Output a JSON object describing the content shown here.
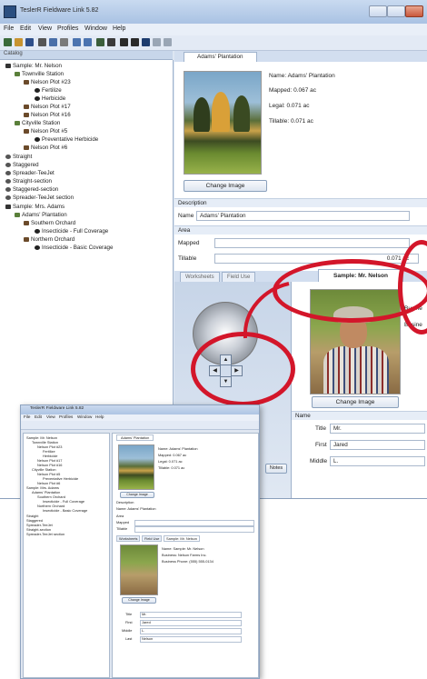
{
  "window": {
    "title": "TeslerR Fieldware Link 5.82",
    "menu": [
      "File",
      "Edit",
      "View",
      "Profiles",
      "Window",
      "Help"
    ]
  },
  "catalog": {
    "header": "Catalog",
    "tree": [
      {
        "label": "Sample: Mr. Nelson",
        "level": 0,
        "icon": "person-icon"
      },
      {
        "label": "Townville Station",
        "level": 1,
        "icon": "farm-icon"
      },
      {
        "label": "Nelson Plot #23",
        "level": 2,
        "icon": "field-icon"
      },
      {
        "label": "Fertilize",
        "level": 3,
        "icon": "spray-icon"
      },
      {
        "label": "Herbicide",
        "level": 3,
        "icon": "spray-icon"
      },
      {
        "label": "Nelson Plot #17",
        "level": 2,
        "icon": "field-icon"
      },
      {
        "label": "Nelson Plot #16",
        "level": 2,
        "icon": "field-icon"
      },
      {
        "label": "Cityville Station",
        "level": 1,
        "icon": "farm-icon"
      },
      {
        "label": "Nelson Plot #5",
        "level": 2,
        "icon": "field-icon"
      },
      {
        "label": "Preventative Herbicide",
        "level": 3,
        "icon": "spray-icon"
      },
      {
        "label": "Nelson Plot #6",
        "level": 2,
        "icon": "field-icon"
      },
      {
        "label": "Straight",
        "level": 0,
        "icon": "pattern-icon"
      },
      {
        "label": "Staggered",
        "level": 0,
        "icon": "pattern-icon"
      },
      {
        "label": "Spreader-TeeJet",
        "level": 0,
        "icon": "pattern-icon"
      },
      {
        "label": "Straight-section",
        "level": 0,
        "icon": "pattern-icon"
      },
      {
        "label": "Staggered-section",
        "level": 0,
        "icon": "pattern-icon"
      },
      {
        "label": "Spreader-TeeJet section",
        "level": 0,
        "icon": "pattern-icon"
      },
      {
        "label": "Sample: Mrs. Adams",
        "level": 0,
        "icon": "person-icon"
      },
      {
        "label": "Adams' Plantation",
        "level": 1,
        "icon": "farm-icon"
      },
      {
        "label": "Southern Orchard",
        "level": 2,
        "icon": "field-icon"
      },
      {
        "label": "Insecticide - Full Coverage",
        "level": 3,
        "icon": "spray-icon"
      },
      {
        "label": "Northern Orchard",
        "level": 2,
        "icon": "field-icon"
      },
      {
        "label": "Insecticide - Basic Coverage",
        "level": 3,
        "icon": "spray-icon"
      }
    ]
  },
  "document": {
    "tab": "Adams' Plantation",
    "info": {
      "name": "Name: Adams' Plantation",
      "mapped": "Mapped: 0.067 ac",
      "legal": "Legal: 0.071 ac",
      "tillable": "Tillable: 0.071 ac"
    },
    "change_image": "Change Image",
    "description_label": "Description",
    "name_label": "Name",
    "name_value": "Adams' Plantation",
    "area_label": "Area",
    "mapped_label": "Mapped",
    "tillable_label": "Tillable",
    "tillable_value": "0.071 ac"
  },
  "bottom": {
    "tabs": [
      "Worksheets",
      "Field Use"
    ],
    "profile_tab": "Sample: Mr. Nelson",
    "change_image": "Change Image",
    "name_group": "Name",
    "title_label": "Title",
    "title_value": "Mr.",
    "first_label": "First",
    "first_value": "Jared",
    "middle_label": "Middle",
    "middle_value": "L.",
    "busi_1": "Busine",
    "busi_2": "Busine",
    "footer_tab": "Notes"
  },
  "inset": {
    "title": "TeslerR Fieldware Link 5.82",
    "doc_tab": "Adams' Plantation",
    "info_name": "Name: Adams' Plantation",
    "info_mapped": "Mapped: 0.067 ac",
    "info_legal": "Legal: 0.071 ac",
    "info_tillable": "Tillable: 0.071 ac",
    "change_image": "Change Image",
    "description": "Description",
    "name_line": "Name: Adams' Plantation",
    "area": "Area",
    "mapped": "Mapped",
    "tillable": "Tillable",
    "tabs": [
      "Worksheets",
      "Field Use",
      "Sample: Mr. Nelson"
    ],
    "prof_name": "Name: Sample: Mr. Nelson",
    "prof_business": "Business: Nelson Farms Inc.",
    "prof_phone": "Business Phone: (555) 555-0134",
    "prof_change": "Change Image",
    "title_label": "Title",
    "title_value": "Mr.",
    "first_label": "First",
    "first_value": "Jared",
    "middle_label": "Middle",
    "middle_value": "L.",
    "last_label": "Last",
    "last_value": "Nelson"
  }
}
